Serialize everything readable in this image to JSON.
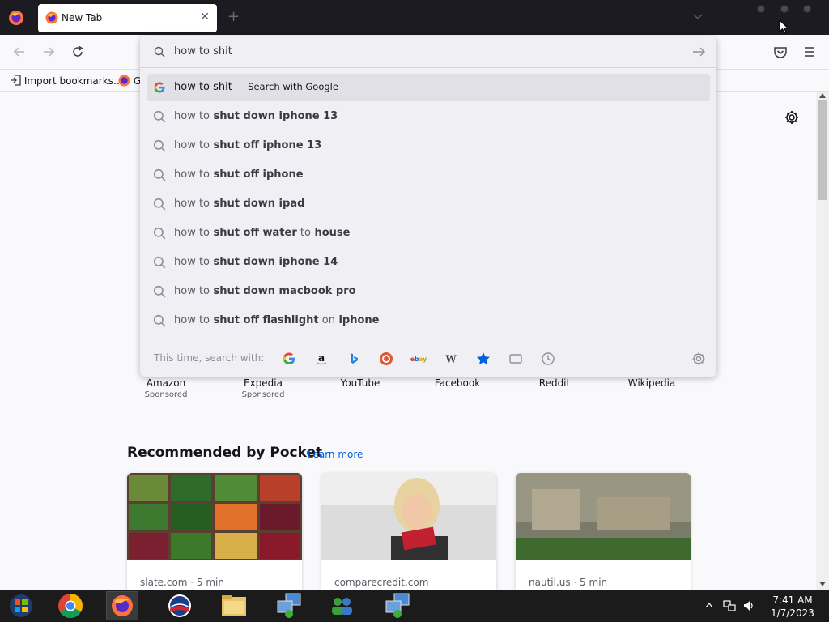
{
  "browser": {
    "tab_title": "New Tab",
    "bookmarks": [
      {
        "label": "Import bookmarks…"
      },
      {
        "label": "Ge"
      }
    ]
  },
  "urlbar": {
    "query": "how to shit",
    "suggestions": [
      {
        "typed": "how to shit",
        "completion": "",
        "note": "— Search with Google"
      },
      {
        "typed": "how to",
        "completion": " shut down iphone 13"
      },
      {
        "typed": "how to",
        "completion": " shut off iphone 13"
      },
      {
        "typed": "how to",
        "completion": " shut off iphone"
      },
      {
        "typed": "how to",
        "completion": " shut down ipad"
      },
      {
        "typed": "how to",
        "completion": " shut off water",
        "tail_light": " to",
        "tail_bold": " house"
      },
      {
        "typed": "how to",
        "completion": " shut down iphone 14"
      },
      {
        "typed": "how to",
        "completion": " shut down macbook pro"
      },
      {
        "typed": "how to",
        "completion": " shut off flashlight",
        "tail_light": " on",
        "tail_bold": " iphone"
      }
    ],
    "one_off_label": "This time, search with:",
    "one_off_engines": [
      "google-icon",
      "amazon-icon",
      "bing-icon",
      "duckduckgo-icon",
      "ebay-icon",
      "wikipedia-icon",
      "bookmarks-icon",
      "tabs-icon",
      "history-icon"
    ]
  },
  "top_sites": [
    {
      "name": "Amazon",
      "sponsored": "Sponsored"
    },
    {
      "name": "Expedia",
      "sponsored": "Sponsored"
    },
    {
      "name": "YouTube",
      "sponsored": ""
    },
    {
      "name": "Facebook",
      "sponsored": ""
    },
    {
      "name": "Reddit",
      "sponsored": ""
    },
    {
      "name": "Wikipedia",
      "sponsored": ""
    }
  ],
  "pocket": {
    "title": "Recommended by Pocket",
    "learn_more": "Learn more",
    "cards": [
      {
        "source": "slate.com · 5 min"
      },
      {
        "source": "comparecredit.com"
      },
      {
        "source": "nautil.us · 5 min"
      }
    ]
  },
  "taskbar": {
    "time": "7:41 AM",
    "date": "1/7/2023"
  },
  "colors": {
    "accent": "#0061e0",
    "taskbar": "#1b1b1b",
    "titlebar": "#1c1b22"
  }
}
